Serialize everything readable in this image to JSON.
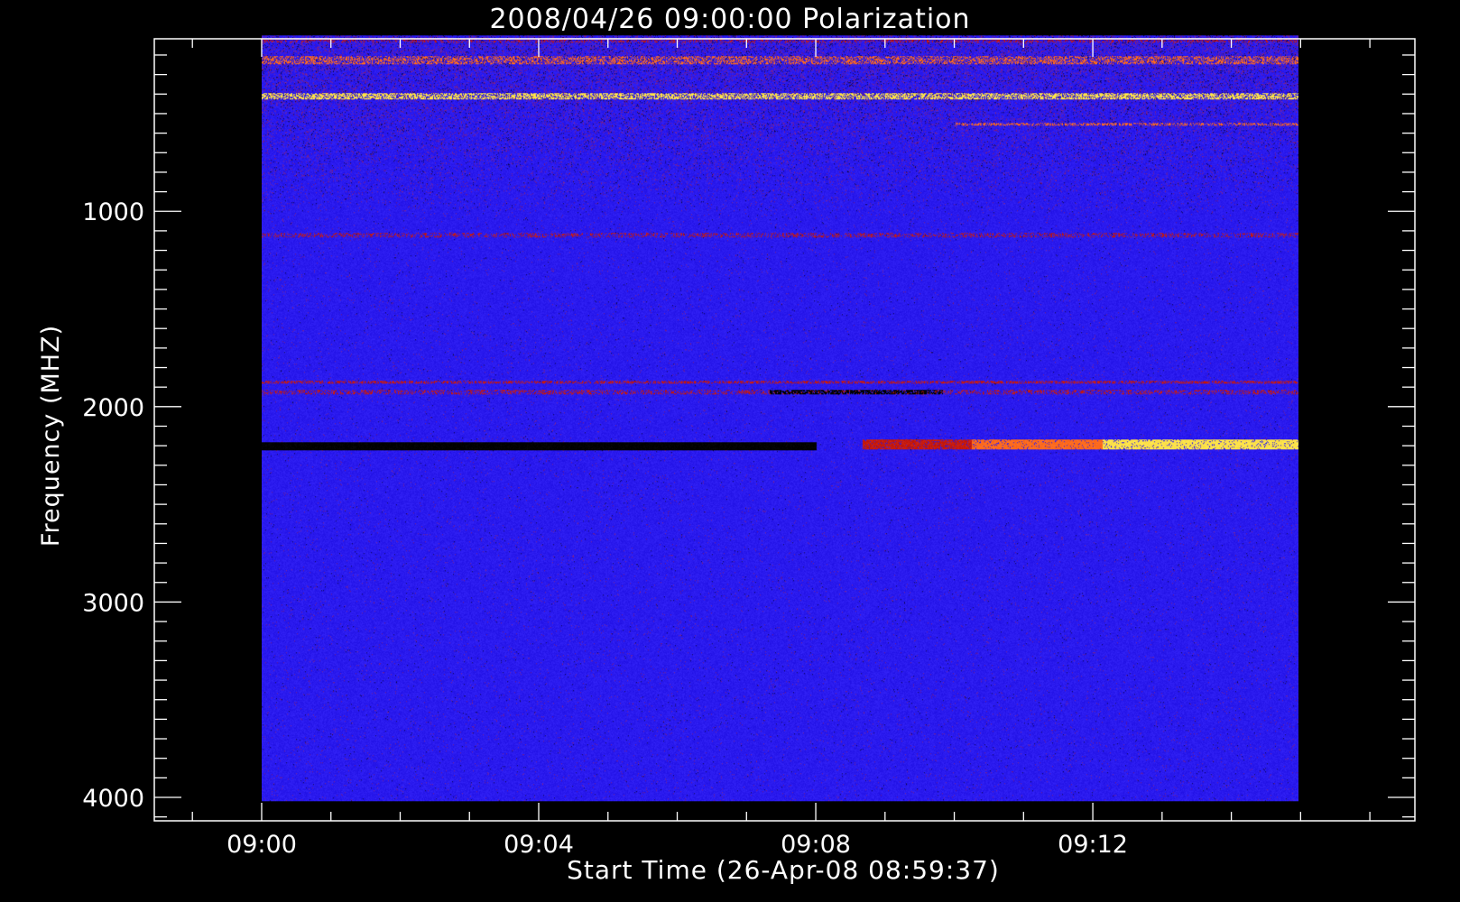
{
  "chart_data": {
    "type": "heatmap",
    "title": "2008/04/26 09:00:00 Polarization",
    "xlabel": "Start Time (26-Apr-08 08:59:37)",
    "ylabel": "Frequency (MHZ)",
    "x_axis": {
      "unit": "time",
      "range": [
        "08:58:27",
        "09:16:39"
      ],
      "data_range": [
        "09:00:00",
        "09:14:58"
      ],
      "major_ticks": [
        "09:00",
        "09:04",
        "09:08",
        "09:12"
      ],
      "minor_tick_step_seconds": 60
    },
    "y_axis": {
      "unit": "MHz",
      "inverted": true,
      "range": [
        117,
        4120
      ],
      "data_range": [
        100,
        4020
      ],
      "major_ticks": [
        1000,
        2000,
        3000,
        4000
      ],
      "minor_tick_step": 100
    },
    "grid": false,
    "colors": {
      "background": "#000000",
      "frame": "#ffffff",
      "baseline": "#2a1aee",
      "red": "#c51a10",
      "orange": "#ff6a1e",
      "yellow": "#ffe24a",
      "black": "#000000"
    },
    "features": [
      {
        "name": "rfi-band",
        "f_lo": 115,
        "f_hi": 135,
        "t_start": "09:00:00",
        "t_end": "09:14:58",
        "level": "red",
        "density": 0.3
      },
      {
        "name": "rfi-band",
        "f_lo": 205,
        "f_hi": 245,
        "t_start": "09:00:00",
        "t_end": "09:14:58",
        "level": "orange",
        "density": 0.45
      },
      {
        "name": "rfi-band",
        "f_lo": 395,
        "f_hi": 425,
        "t_start": "09:00:00",
        "t_end": "09:14:58",
        "level": "yellow",
        "density": 0.6
      },
      {
        "name": "rfi-band",
        "f_lo": 545,
        "f_hi": 560,
        "t_start": "09:10:00",
        "t_end": "09:14:58",
        "level": "orange",
        "density": 0.5
      },
      {
        "name": "rfi-band",
        "f_lo": 1110,
        "f_hi": 1130,
        "t_start": "09:00:00",
        "t_end": "09:14:58",
        "level": "red",
        "density": 0.3
      },
      {
        "name": "rfi-band",
        "f_lo": 1865,
        "f_hi": 1880,
        "t_start": "09:00:00",
        "t_end": "09:14:58",
        "level": "red",
        "density": 0.55
      },
      {
        "name": "rfi-band",
        "f_lo": 1910,
        "f_hi": 1935,
        "t_start": "09:00:00",
        "t_end": "09:14:58",
        "level": "red",
        "density": 0.35
      },
      {
        "name": "black-band",
        "f_lo": 1910,
        "f_hi": 1935,
        "t_start": "09:07:20",
        "t_end": "09:09:50",
        "level": "black",
        "density": 0.7
      },
      {
        "name": "black-band",
        "f_lo": 2180,
        "f_hi": 2220,
        "t_start": "09:00:00",
        "t_end": "09:08:00",
        "level": "black",
        "density": 1.0
      },
      {
        "name": "emission-band",
        "f_lo": 2165,
        "f_hi": 2215,
        "t_start": "09:08:40",
        "t_end": "09:14:58",
        "level": "yellow",
        "density": 0.9
      }
    ]
  }
}
